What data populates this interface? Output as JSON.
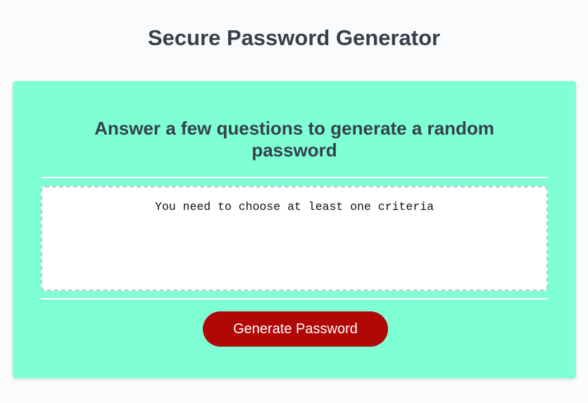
{
  "header": {
    "title": "Secure Password Generator"
  },
  "card": {
    "heading": "Answer a few questions to generate a random password",
    "password_output": "You need to choose at least one criteria",
    "generate_label": "Generate Password"
  }
}
